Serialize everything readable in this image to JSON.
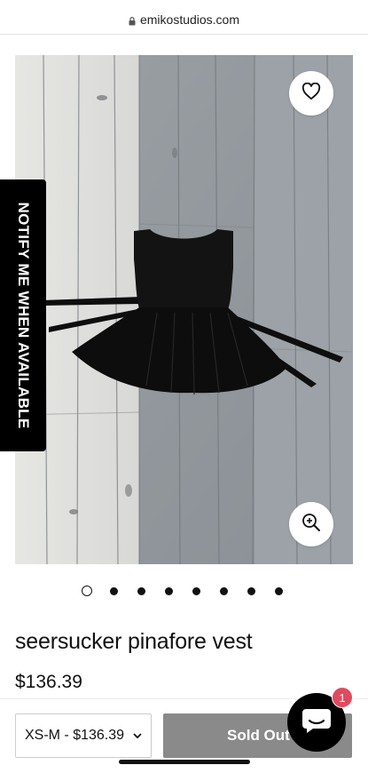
{
  "browser": {
    "url": "emikostudios.com",
    "icons": {
      "lock": "lock-icon"
    }
  },
  "notify": {
    "label": "NOTIFY ME WHEN AVAILABLE"
  },
  "gallery": {
    "slide_count": 8,
    "active_index": 0,
    "icons": {
      "wishlist": "heart-icon",
      "zoom": "zoom-in-icon"
    }
  },
  "product": {
    "title": "seersucker pinafore vest",
    "price": "$136.39"
  },
  "purchase": {
    "variant_selected": "XS-M - $136.39",
    "button_label": "Sold Out",
    "icons": {
      "variant": "chevron-down-icon"
    }
  },
  "chat": {
    "badge_count": "1",
    "icon": "chat-bubble-icon"
  },
  "colors": {
    "notify_bg": "#000000",
    "sold_out_bg": "#8a8a8a",
    "badge_bg": "#e04a5f"
  }
}
